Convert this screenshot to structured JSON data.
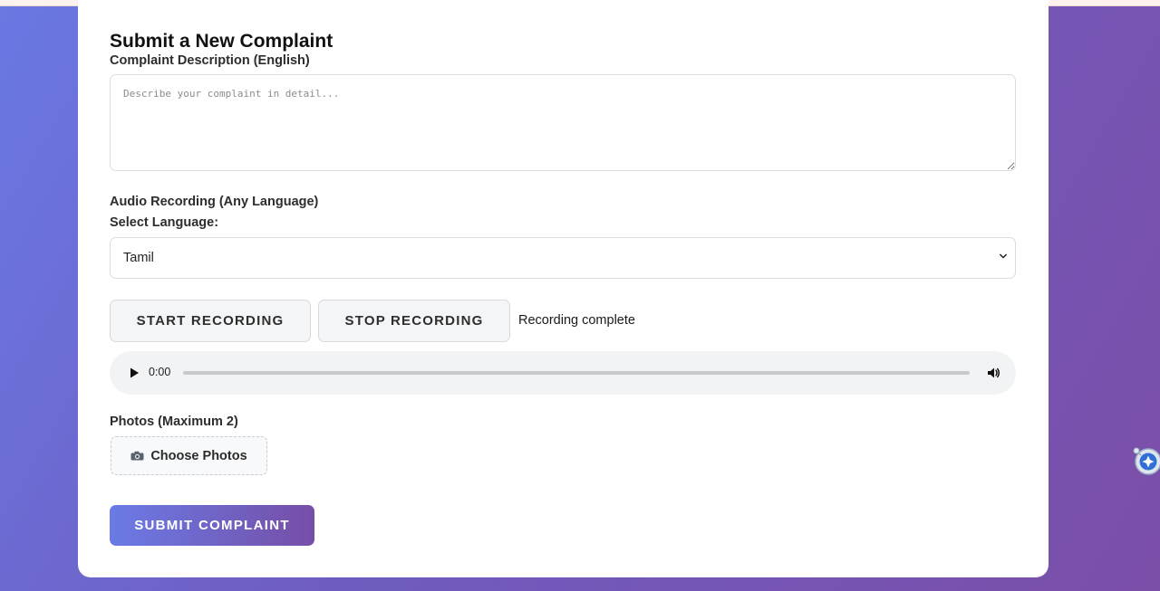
{
  "form": {
    "title": "Submit a New Complaint",
    "description_label": "Complaint Description (English)",
    "description_placeholder": "Describe your complaint in detail...",
    "description_value": "",
    "audio_section_label": "Audio Recording (Any Language)",
    "language_label": "Select Language:",
    "language_selected": "Tamil",
    "start_recording_label": "START RECORDING",
    "stop_recording_label": "STOP RECORDING",
    "recording_status": "Recording complete",
    "audio_player": {
      "current_time": "0:00",
      "progress": 0
    },
    "photos_label": "Photos (Maximum 2)",
    "choose_photos_label": "Choose Photos",
    "choose_photos_icon": "camera-icon",
    "submit_label": "SUBMIT COMPLAINT"
  },
  "colors": {
    "background_start": "#6a78e3",
    "background_end": "#7b4ea8",
    "submit_gradient_start": "#6a7be6",
    "submit_gradient_end": "#764ea7",
    "card": "#ffffff"
  },
  "icons": {
    "play": "play-icon",
    "volume": "volume-icon",
    "select_chevron": "chevron-down-icon",
    "extension": "extension-assistant-icon"
  }
}
